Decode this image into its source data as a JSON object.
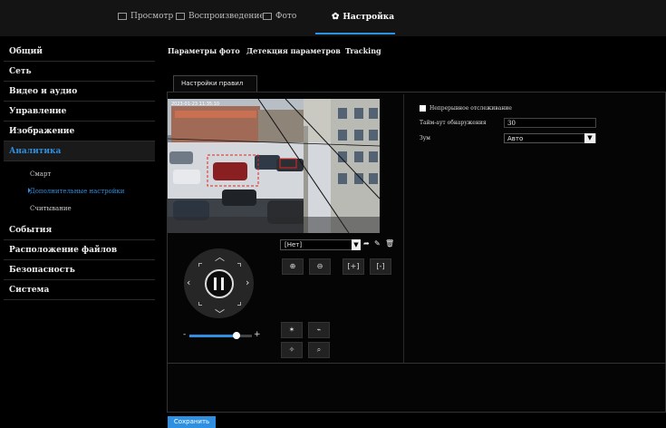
{
  "topnav": {
    "live": "Просмотр",
    "playback": "Воспроизведение",
    "photo": "Фото",
    "settings": "Настройка"
  },
  "sidebar": {
    "items": [
      {
        "label": "Общий"
      },
      {
        "label": "Сеть"
      },
      {
        "label": "Видео и аудио"
      },
      {
        "label": "Управление"
      },
      {
        "label": "Изображение"
      },
      {
        "label": "Аналитика"
      },
      {
        "label": "События"
      },
      {
        "label": "Расположение файлов"
      },
      {
        "label": "Безопасность"
      },
      {
        "label": "Система"
      }
    ],
    "subitems": [
      {
        "label": "Смарт"
      },
      {
        "label": "Дополнительные настройки"
      },
      {
        "label": "Считывание"
      }
    ],
    "active_item": "Аналитика",
    "active_subitem": "Дополнительные настройки"
  },
  "subtabs": {
    "photo_params": "Параметры фото",
    "param_detection": "Детекция параметров",
    "tracking": "Tracking"
  },
  "rule_tab": "Настройки правил",
  "video": {
    "overlay_text": "2023-01-23 11:35:10"
  },
  "ptz": {
    "preset_value": "[Нет]",
    "slider_minus": "-",
    "slider_plus": "+",
    "slider_level": 0.75
  },
  "settings": {
    "continuous_tracking_label": "Непрерывное отслеживание",
    "continuous_tracking_checked": false,
    "detection_timeout_label": "Тайм-аут обнаружения",
    "detection_timeout_value": "30",
    "zoom_label": "Зум",
    "zoom_value": "Авто"
  },
  "save_button": "Сохранить",
  "colors": {
    "accent": "#2f8fe0",
    "background": "#000000",
    "topbar": "#141414"
  }
}
